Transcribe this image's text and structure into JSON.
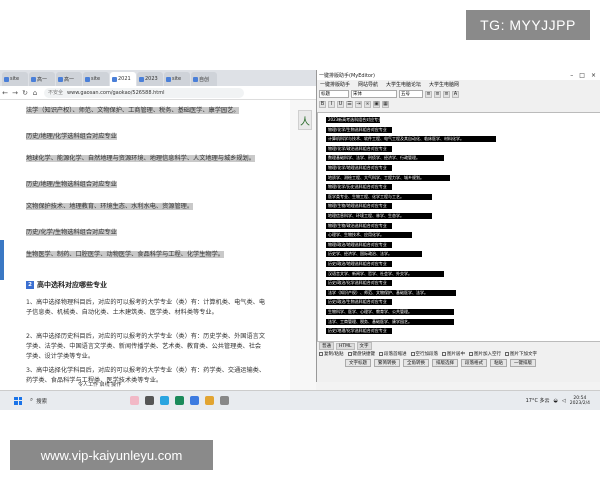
{
  "watermark_top": "TG: MYYJJPP",
  "watermark_bottom": "www.vip-kaiyunleyu.com",
  "browser": {
    "tabs": [
      "site",
      "高一",
      "高一",
      "site",
      "2021",
      "2023",
      "site",
      "自创"
    ],
    "security_label": "不安全",
    "url": "www.gaosan.com/gaokao/526588.html",
    "paragraphs": [
      {
        "text": "法学（知识产权）、师范、文物保护、工商管理、税务、基础医学、康学园艺。",
        "highlight": true
      },
      {
        "text": "历史/地理/化学选科组合对应专业",
        "highlight": true
      },
      {
        "text": "地球化学、能源化学、自然地理与资源环境、地理信息科学、人文地理与城乡规划。",
        "highlight": true
      },
      {
        "text": "历史/地理/生物选科组合对应专业",
        "highlight": true
      },
      {
        "text": "文物保护技术、地理教育、环境生态、水利水电、资源管理。",
        "highlight": true
      },
      {
        "text": "历史/化学/生物选科组合对应专业",
        "highlight": true
      },
      {
        "text": "生物医学、制药、口腔医学、动物医学、食品科学与工程、化学生物学。",
        "highlight": true
      }
    ],
    "section_number": "2",
    "section_title": "高中选科对应哪些专业",
    "body_paragraphs": [
      "1、高中选择物理科目后，对应的可以报考的大学专业（类）有：计算机类、电气类、电子信息类、机械类、自动化类、土木建筑类、医学类、材料类等专业。",
      "2、高中选择历史科目后，对应的可以报考的大学专业（类）有：历史学类、外国语言文学类、法学类、中国语言文学类、新闻传播学类、艺术类、教育类、公共管理类、社会学类、设计学类等专业。",
      "3、高中选择化学科目后，对应的可以报考的大学专业（类）有：药学类、交通运输类、药学类、食品科学与工程类、医学技术类等专业。"
    ],
    "side_icon": "人"
  },
  "editor": {
    "title": "一键排版助手(MyEditor)",
    "menu": [
      "一键排版助手",
      "网站导航",
      "大学生电脑论坛",
      "大学生电脑网"
    ],
    "toolbar": {
      "style_select": "标题",
      "font_select": "宋体",
      "size_select": "五号"
    },
    "lines": [
      "2023新高考选科组合对应专业",
      "物理/化学/生物选科组合对应专业",
      "计算机科学与技术、软件工程、电气工程及其自动化、临床医学、材料化学。",
      "物理/化学/政治选科组合对应专业",
      "数理基础科学、法学、刑侦学、经济学、行政管理。",
      "物理/化学/地理选科组合对应专业",
      "地质学、测绘工程、大气科学、工程力学、城乡规划。",
      "物理/化学/历史选科组合对应专业",
      "医学类专业、生物工程、化学工程与工艺。",
      "物理/生物/地理选科组合对应专业",
      "地理信息科学、环境工程、林学、生态学。",
      "物理/生物/政治选科组合对应专业",
      "心理学、生物技术、应用化学。",
      "物理/政治/地理选科组合对应专业",
      "历史学、经济学、国际政治、法学。",
      "历史/政治/地理选科组合对应专业",
      "汉语言文学、新闻学、哲学、社会学、外交学。",
      "历史/政治/化学选科组合对应专业",
      "法学（知识产权）、师范、文物保护、基础医学、法学。",
      "历史/政治/生物选科组合对应专业",
      "生物科学、医学、心理学、教育学、公共管理。",
      "法学、工商管理、税务、基础医学、康学园艺。",
      "历史/地理/化学选科组合对应专业"
    ],
    "bottom_tabs": [
      "普通",
      "HTML",
      "文字"
    ],
    "options": [
      "复制/粘贴",
      "键盘快捷键",
      "段落首缩进",
      "空行加段落",
      "图片居中",
      "图片加入空行",
      "图片下加文字"
    ],
    "buttons": [
      "文字标题",
      "繁简转换",
      "全角转换",
      "排版选择",
      "段落格式",
      "粘贴",
      "一键排版"
    ]
  },
  "taskbar": {
    "search_label": "搜索",
    "weather": "17°C 多云",
    "time": "20:54",
    "date": "2023/2/4",
    "bottom_text": "令人工作 启线 操作"
  }
}
